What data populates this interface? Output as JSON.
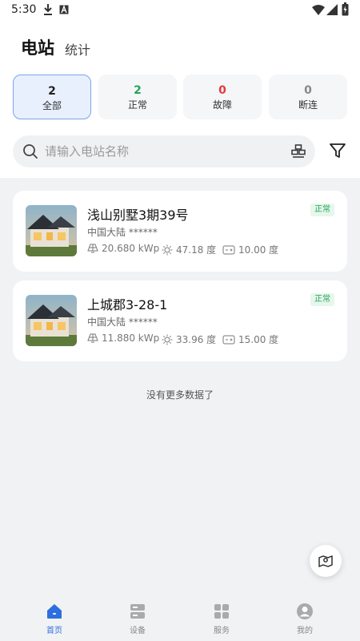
{
  "status_bar": {
    "time": "5:30"
  },
  "header": {
    "tab_active": "电站",
    "tab_other": "统计"
  },
  "filters": [
    {
      "count": "2",
      "label": "全部",
      "color": "#222222"
    },
    {
      "count": "2",
      "label": "正常",
      "color": "#27a35a"
    },
    {
      "count": "0",
      "label": "故障",
      "color": "#e23b3b"
    },
    {
      "count": "0",
      "label": "断连",
      "color": "#888888"
    }
  ],
  "search": {
    "placeholder": "请输入电站名称"
  },
  "stations": [
    {
      "name": "浅山别墅3期39号",
      "region": "中国大陆 ******",
      "status": "正常",
      "capacity": "20.680 kWp",
      "irradiance": "47.18 度",
      "energy": "10.00 度"
    },
    {
      "name": "上城郡3-28-1",
      "region": "中国大陆 ******",
      "status": "正常",
      "capacity": "11.880 kWp",
      "irradiance": "33.96 度",
      "energy": "15.00 度"
    }
  ],
  "list_end_text": "没有更多数据了",
  "bottom_nav": [
    {
      "label": "首页",
      "icon": "home-icon"
    },
    {
      "label": "设备",
      "icon": "device-icon"
    },
    {
      "label": "服务",
      "icon": "service-icon"
    },
    {
      "label": "我的",
      "icon": "profile-icon"
    }
  ],
  "colors": {
    "accent": "#2e6fe0",
    "normal": "#27a35a",
    "fault": "#e23b3b"
  }
}
